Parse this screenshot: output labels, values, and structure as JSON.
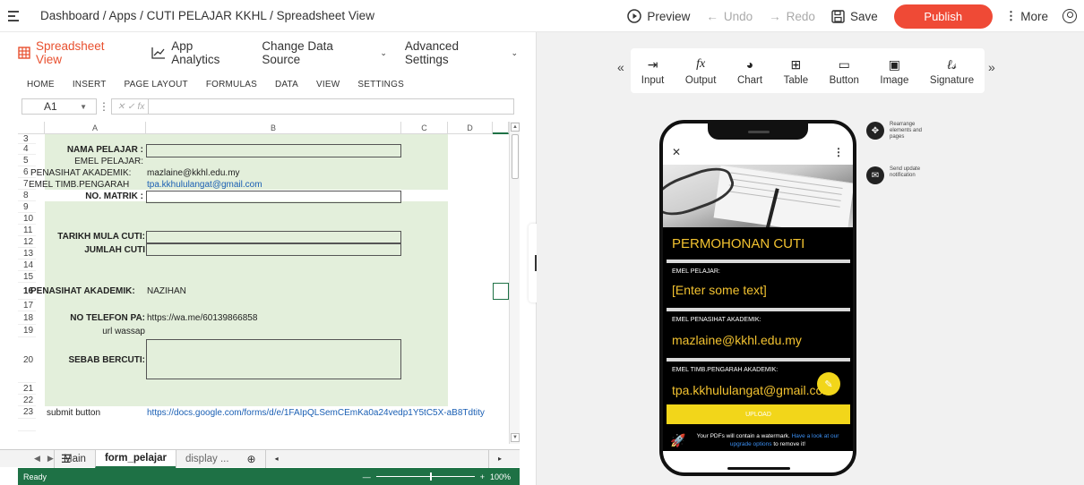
{
  "topbar": {
    "breadcrumb": "Dashboard / Apps / CUTI PELAJAR KKHL / Spreadsheet View",
    "preview": "Preview",
    "undo": "Undo",
    "redo": "Redo",
    "save": "Save",
    "publish": "Publish",
    "more": "More"
  },
  "tabs": {
    "spreadsheet": "Spreadsheet View",
    "analytics": "App Analytics",
    "datasource": "Change Data Source",
    "advanced": "Advanced Settings"
  },
  "ribbon": [
    "HOME",
    "INSERT",
    "PAGE LAYOUT",
    "FORMULAS",
    "DATA",
    "VIEW",
    "SETTINGS"
  ],
  "formula": {
    "cell_ref": "A1",
    "fx": "fx"
  },
  "columns": [
    "A",
    "B",
    "C",
    "D"
  ],
  "rows": [
    "3",
    "4",
    "5",
    "6",
    "7",
    "8",
    "9",
    "10",
    "11",
    "12",
    "13",
    "14",
    "15",
    "16",
    "17",
    "18",
    "19",
    "20",
    "21",
    "22",
    "23"
  ],
  "cells": {
    "r4": "NAMA PELAJAR :",
    "r5": "EMEL PELAJAR:",
    "r6a": "PENASIHAT AKADEMIK:",
    "r6b": "mazlaine@kkhl.edu.my",
    "r7a": "EMEL TIMB.PENGARAH",
    "r7b": "tpa.kkhululangat@gmail.com",
    "r8": "NO. MATRIK :",
    "r11": "TARIKH MULA CUTI:",
    "r12": "JUMLAH CUTI",
    "r15a": "PENASIHAT AKADEMIK:",
    "r15b": "NAZIHAN",
    "r17a": "NO TELEFON PA:",
    "r17b": "https://wa.me/60139866858",
    "r18": "url wassap",
    "r19": "SEBAB BERCUTI:",
    "r22a": "submit button",
    "r22b": "https://docs.google.com/forms/d/e/1FAIpQLSemCEmKa0a24vedp1Y5tC5X-aB8Tdtity"
  },
  "sheets": [
    "Main",
    "form_pelajar",
    "display ..."
  ],
  "status": {
    "ready": "Ready",
    "zoom": "100%"
  },
  "palette": [
    "Input",
    "Output",
    "Chart",
    "Table",
    "Button",
    "Image",
    "Signature"
  ],
  "app": {
    "title": "PERMOHONAN CUTI",
    "field1_label": "EMEL PELAJAR:",
    "field1_value": "[Enter some text]",
    "field2_label": "EMEL PENASIHAT AKADEMIK:",
    "field2_value": "mazlaine@kkhl.edu.my",
    "field3_label": "EMEL TIMB.PENGARAH AKADEMIK:",
    "field3_value": "tpa.kkhululangat@gmail.com",
    "upload": "UPLOAD",
    "watermark_text": "Your PDFs will contain a watermark.",
    "watermark_link": "Have a look at our upgrade options",
    "watermark_tail": "to remove it!"
  },
  "tools": {
    "rearrange": "Rearrange elements and pages",
    "notify": "Send update notification"
  },
  "colors": {
    "accent": "#e8502f",
    "publish": "#ef4a36",
    "excel_green": "#1e7145",
    "app_yellow": "#f2c230"
  }
}
